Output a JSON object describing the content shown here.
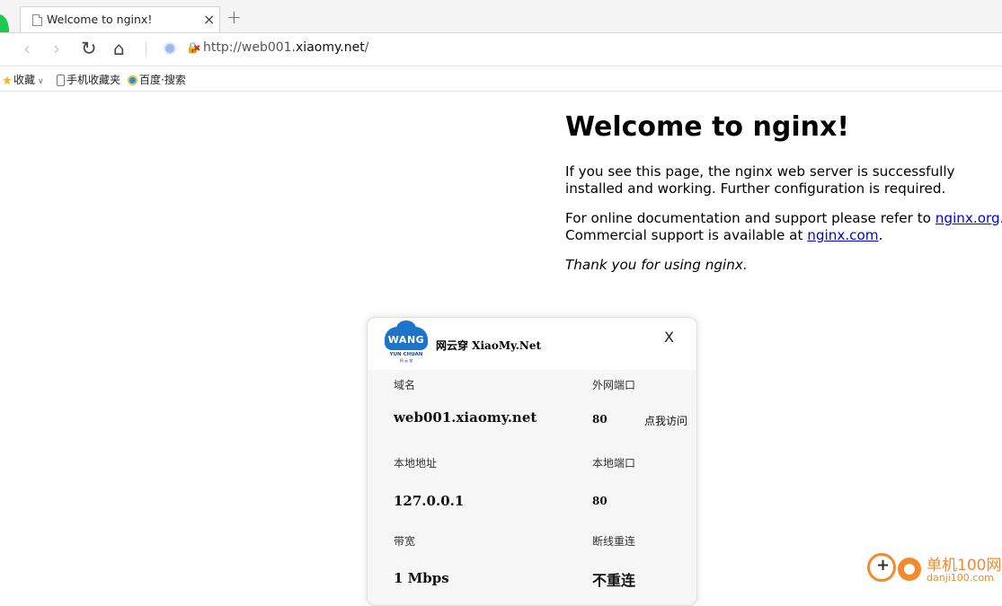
{
  "browser": {
    "tab_title": "Welcome to nginx!",
    "tab_close": "×",
    "new_tab": "+",
    "url_prefix": "http://web001.",
    "url_domain": "xiaomy.net",
    "url_suffix": "/",
    "bookmarks": [
      {
        "label": "收藏",
        "icon": "star-icon"
      },
      {
        "label": "手机收藏夹",
        "icon": "phone-icon"
      },
      {
        "label": "百度·搜索",
        "icon": "ie-icon"
      }
    ]
  },
  "page": {
    "heading": "Welcome to nginx!",
    "p1": "If you see this page, the nginx web server is successfully installed and working. Further configuration is required.",
    "p2_pre": "For online documentation and support please refer to ",
    "link1": "nginx.org",
    "p2_mid": ". Commercial support is available at ",
    "link2": "nginx.com",
    "p2_end": ".",
    "p3": "Thank you for using nginx."
  },
  "popup": {
    "logo_text": "WANG",
    "logo_sub": "YUN CHUAN",
    "logo_sub2": "网 云 穿",
    "brand": "网云穿 XiaoMy.Net",
    "close": "X",
    "domain_label": "域名",
    "domain_value": "web001.xiaomy.net",
    "external_port_label": "外网端口",
    "external_port_value": "80",
    "visit_link": "点我访问",
    "local_address_label": "本地地址",
    "local_address_value": "127.0.0.1",
    "local_port_label": "本地端口",
    "local_port_value": "80",
    "bandwidth_label": "带宽",
    "bandwidth_value": "1 Mbps",
    "reconnect_label": "断线重连",
    "reconnect_value": "不重连"
  },
  "watermark": {
    "title": "单机100网",
    "url": "danji100.com"
  },
  "colors": {
    "link": "#0000ee",
    "logo_blue": "#1c75c8",
    "watermark_orange": "#f28a2e"
  }
}
